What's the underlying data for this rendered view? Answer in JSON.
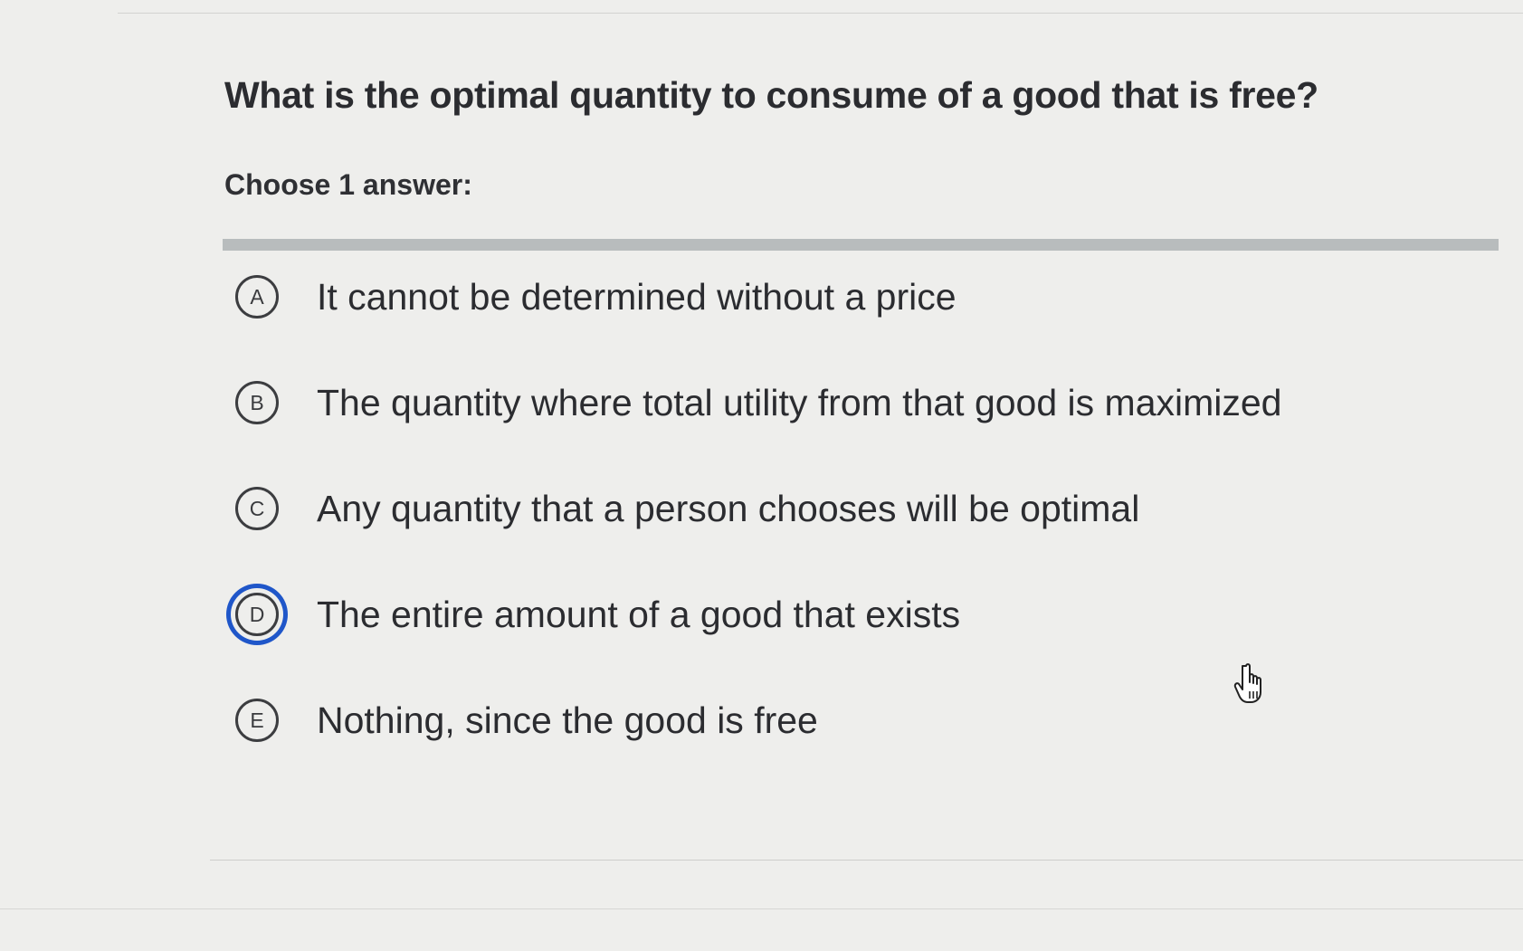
{
  "question": {
    "text": "What is the optimal quantity to consume of a good that is free?",
    "instruction": "Choose 1 answer:"
  },
  "choices": [
    {
      "letter": "A",
      "text": "It cannot be determined without a price",
      "selected": false
    },
    {
      "letter": "B",
      "text": "The quantity where total utility from that good is maximized",
      "selected": false
    },
    {
      "letter": "C",
      "text": "Any quantity that a person chooses will be optimal",
      "selected": false
    },
    {
      "letter": "D",
      "text": "The entire amount of a good that exists",
      "selected": true
    },
    {
      "letter": "E",
      "text": "Nothing, since the good is free",
      "selected": false
    }
  ],
  "colors": {
    "selected_ring": "#1f56c9",
    "text": "#2b2c30",
    "background": "#eeeeec"
  },
  "icons": {
    "cursor": "hand-pointer-icon"
  }
}
